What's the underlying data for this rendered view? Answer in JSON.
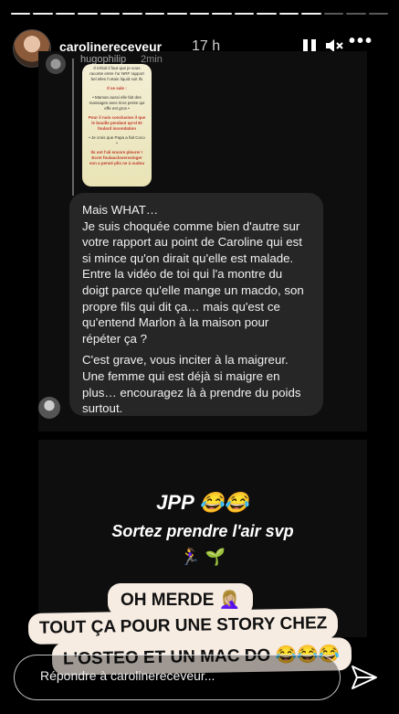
{
  "header": {
    "username": "carolinereceveur",
    "time": "17 h",
    "close_icon": "×"
  },
  "story": {
    "quoted_message": {
      "user": "hugophilip",
      "time": "2min",
      "image_lines": [
        "Il s'éloit il faut que je vous raconte entre l'or NRF rapport bel elles l'ortain liquid soit ifs",
        "Il se sale :",
        "• Maman aussi elle fait des massages avec tiros pente qui effe est gros •",
        "Pour il nuis conclusion il que le bouille pendant qu'el Et foulard incondation",
        "• Je crois que Papa a fait Coco •",
        "Ils ont l'ali encore pleurer ! Ecret foulaucloverssinger son a pensé plis ne à oudou"
      ]
    },
    "reply_message": {
      "paragraphs": [
        "Mais WHAT…",
        "Je suis choquée comme bien d'autre sur votre rapport au point de Caroline qui est si mince qu'on dirait qu'elle est malade. Entre la vidéo de toi qui l'a montre du doigt parce qu'elle mange un macdo, son propre fils qui dit ça… mais qu'est ce qu'entend Marlon à la maison pour répéter ça ?",
        "C'est grave, vous inciter à la maigreur. Une femme qui est déjà si maigre en plus… encouragez là à prendre du poids surtout."
      ]
    },
    "second_panel": {
      "jpp": "JPP 😂😂",
      "sortez": "Sortez prendre l'air svp",
      "emojis": "🏃‍♀️ 🌱"
    },
    "stickers": [
      "OH MERDE 🤦🏼‍♀️",
      "TOUT ÇA POUR UNE STORY CHEZ",
      "L'OSTEO ET UN MAC DO 😂😂😂"
    ]
  },
  "reply_bar": {
    "placeholder": "Répondre à carolinereceveur..."
  },
  "icons": {
    "pause": "pause-icon",
    "mute": "mute-icon",
    "more": "more-icon",
    "close": "close-icon",
    "send": "send-icon"
  }
}
